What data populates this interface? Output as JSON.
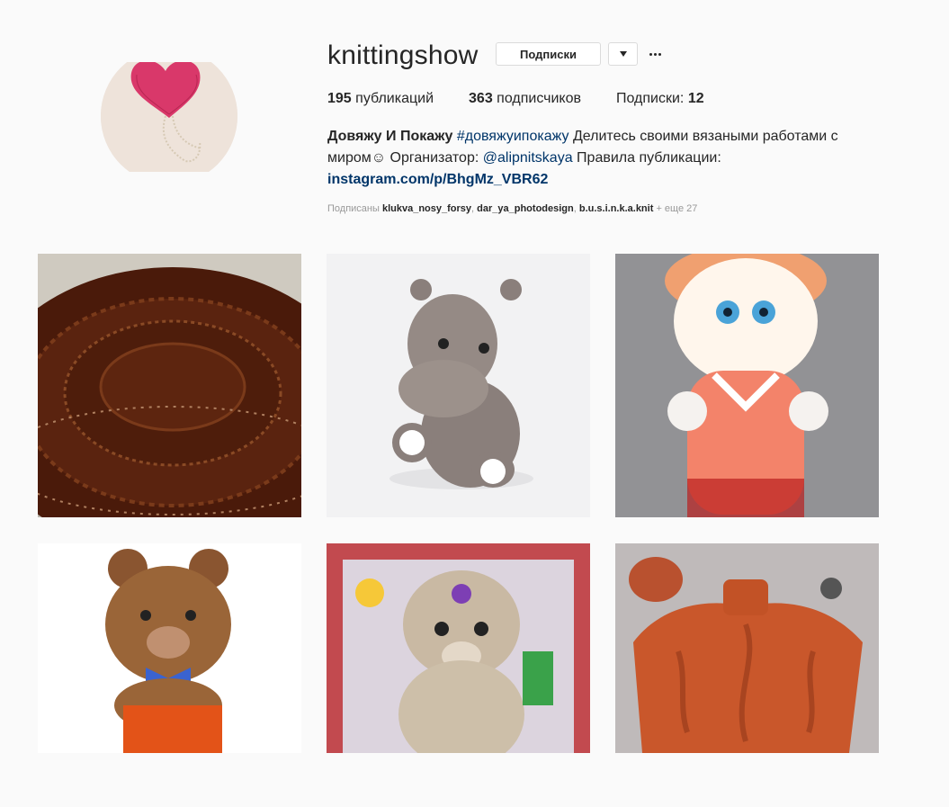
{
  "profile": {
    "username": "knittingshow",
    "follow_label": "Подписки",
    "stats": {
      "posts": "195",
      "posts_label": "публикаций",
      "followers": "363",
      "followers_label": "подписчиков",
      "following_label": "Подписки:",
      "following": "12"
    },
    "bio": {
      "name": "Довяжу И Покажу",
      "hashtag": "#довяжуипокажу",
      "text1": "Делитесь своими вязаными работами с миром☺ Организатор:",
      "mention": "@alipnitskaya",
      "text2": "Правила публикации:",
      "link": "instagram.com/p/BhgMz_VBR62"
    },
    "followed_by": {
      "prefix": "Подписаны",
      "user1": "klukva_nosy_forsy",
      "user2": "dar_ya_photodesign",
      "user3": "b.u.s.i.n.k.a.knit",
      "more": "+ еще 27"
    }
  },
  "posts": [
    {
      "subject": "brown crochet oval rug"
    },
    {
      "subject": "grey amigurumi hippo"
    },
    {
      "subject": "peach plush bunny doll"
    },
    {
      "subject": "brown plush bear with blue bow"
    },
    {
      "subject": "knitted puppy with green badge"
    },
    {
      "subject": "orange cable knit sweater"
    }
  ],
  "icons": {
    "dropdown": "chevron-down-icon",
    "more": "more-horizontal-icon"
  },
  "colors": {
    "background": "#fafafa",
    "text": "#262626",
    "link": "#003569",
    "muted": "#999999",
    "border": "#dbdbdb"
  }
}
